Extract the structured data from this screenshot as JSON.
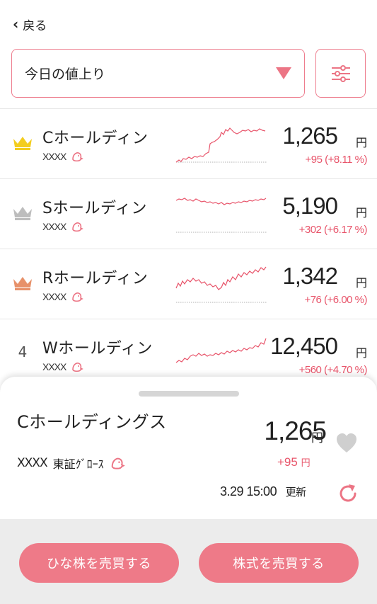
{
  "nav": {
    "back_label": "戻る"
  },
  "dropdown": {
    "selected": "今日の値上り"
  },
  "rows": [
    {
      "rank": "1",
      "name": "Cホールディン",
      "code": "XXXX",
      "price": "1,265",
      "yen": "円",
      "change": "+95 (+8.11 %)",
      "crown_color": "#f3cd1f"
    },
    {
      "rank": "2",
      "name": "Sホールディン",
      "code": "XXXX",
      "price": "5,190",
      "yen": "円",
      "change": "+302 (+6.17 %)",
      "crown_color": "#bdbdbd"
    },
    {
      "rank": "3",
      "name": "Rホールディン",
      "code": "XXXX",
      "price": "1,342",
      "yen": "円",
      "change": "+76 (+6.00 %)",
      "crown_color": "#e7916a"
    },
    {
      "rank": "4",
      "name": "Wホールディン",
      "code": "XXXX",
      "price": "12,450",
      "yen": "円",
      "change": "+560 (+4.70 %)"
    }
  ],
  "detail": {
    "title": "Cホールディングス",
    "code": "XXXX",
    "market": "東証ｸﾞﾛｰｽ",
    "price": "1,265",
    "yen": "円",
    "change": "+95",
    "change_yen": "円",
    "updated_time": "3.29 15:00",
    "updated_label": "更新"
  },
  "buttons": {
    "hina": "ひな株を売買する",
    "stock": "株式を売買する"
  },
  "colors": {
    "accent": "#ee7a88",
    "up": "#e8546a",
    "spark": "#e8546a"
  }
}
